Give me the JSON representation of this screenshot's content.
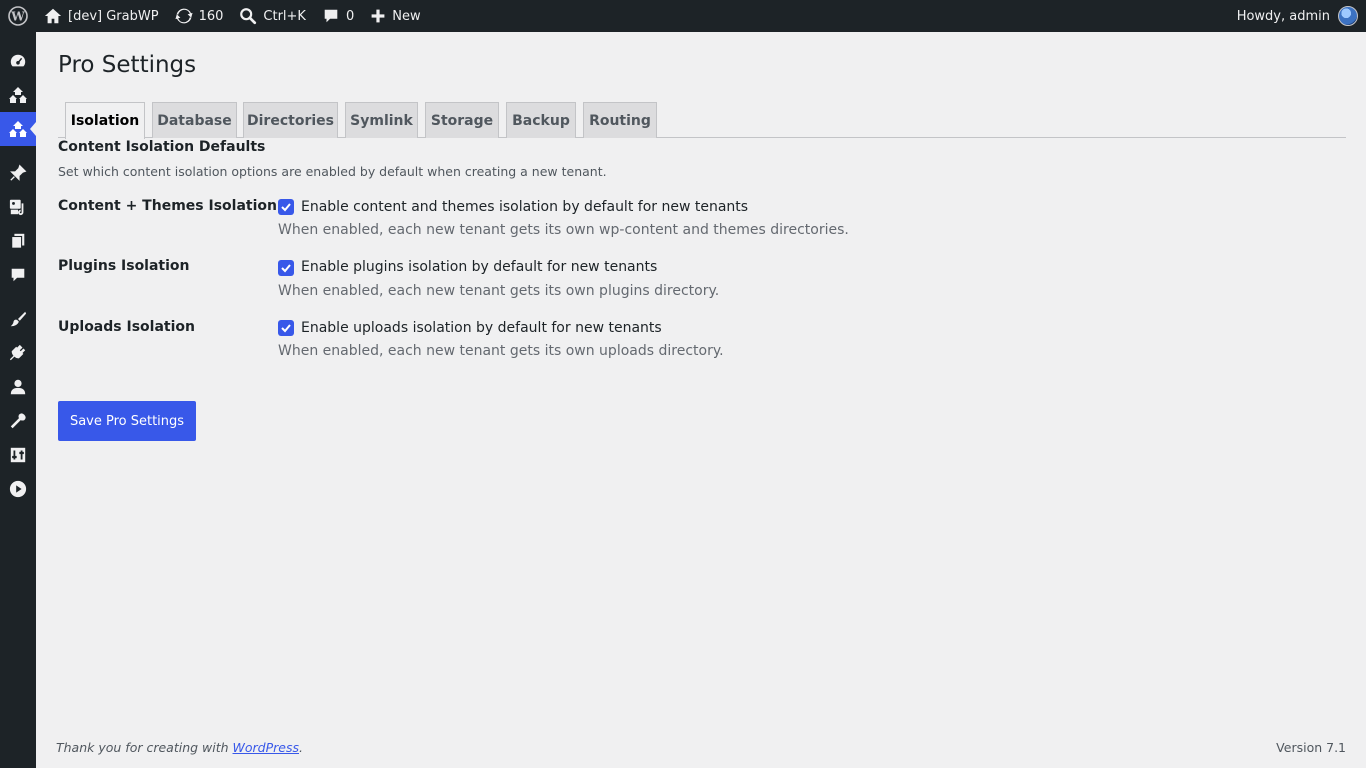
{
  "adminbar": {
    "site_name": "[dev] GrabWP",
    "updates_count": "160",
    "search_shortcut": "Ctrl+K",
    "comments_count": "0",
    "new_label": "New",
    "howdy": "Howdy, admin"
  },
  "sidebar": {
    "items": [
      {
        "icon": "dashboard-icon"
      },
      {
        "icon": "network-icon"
      },
      {
        "icon": "network-icon",
        "current": true
      },
      {
        "icon": "pin-icon"
      },
      {
        "icon": "media-icon"
      },
      {
        "icon": "pages-icon"
      },
      {
        "icon": "comments-icon"
      },
      {
        "icon": "appearance-icon"
      },
      {
        "icon": "plugins-icon"
      },
      {
        "icon": "users-icon"
      },
      {
        "icon": "tools-icon"
      },
      {
        "icon": "settings-icon"
      },
      {
        "icon": "play-icon"
      }
    ]
  },
  "page": {
    "title": "Pro Settings",
    "tabs": [
      "Isolation",
      "Database",
      "Directories",
      "Symlink",
      "Storage",
      "Backup",
      "Routing"
    ],
    "active_tab": "Isolation",
    "section_title": "Content Isolation Defaults",
    "section_desc": "Set which content isolation options are enabled by default when creating a new tenant.",
    "rows": [
      {
        "label": "Content + Themes Isolation",
        "checkbox_label": "Enable content and themes isolation by default for new tenants",
        "checked": true,
        "description": "When enabled, each new tenant gets its own wp-content and themes directories."
      },
      {
        "label": "Plugins Isolation",
        "checkbox_label": "Enable plugins isolation by default for new tenants",
        "checked": true,
        "description": "When enabled, each new tenant gets its own plugins directory."
      },
      {
        "label": "Uploads Isolation",
        "checkbox_label": "Enable uploads isolation by default for new tenants",
        "checked": true,
        "description": "When enabled, each new tenant gets its own uploads directory."
      }
    ],
    "save_label": "Save Pro Settings"
  },
  "footer": {
    "thanks_prefix": "Thank you for creating with ",
    "thanks_link": "WordPress",
    "thanks_suffix": ".",
    "version": "Version 7.1"
  },
  "colors": {
    "accent": "#3858e9",
    "adminbar_bg": "#1d2327",
    "page_bg": "#f0f0f1"
  }
}
